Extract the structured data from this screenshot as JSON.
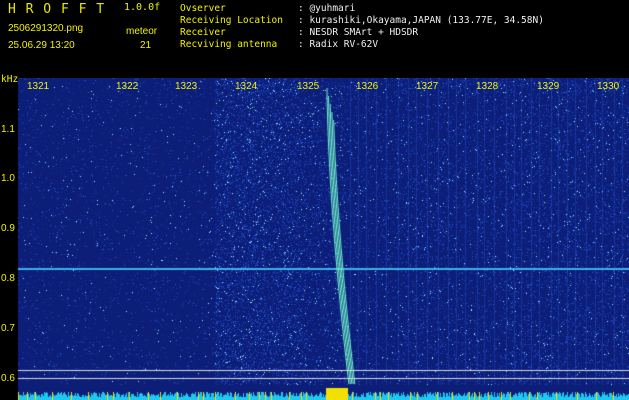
{
  "header": {
    "app_title": "H R O F F T",
    "version": "1.0.0f",
    "filename": "2506291320.png",
    "datetime": "25.06.29 13:20",
    "meteor_label": "meteor",
    "meteor_count": "21"
  },
  "info": [
    {
      "key": "Ovserver",
      "value": ": @yuhmari"
    },
    {
      "key": "Receiving Location",
      "value": ": kurashiki,Okayama,JAPAN (133.77E, 34.58N)"
    },
    {
      "key": "Receiver",
      "value": ": NESDR SMArt + HDSDR"
    },
    {
      "key": "Recviving antenna",
      "value": ": Radix RV-62V"
    }
  ],
  "axis": {
    "unit": "kHz",
    "x_ticks": [
      "1321",
      "1322",
      "1323",
      "1324",
      "1325",
      "1326",
      "1327",
      "1328",
      "1329",
      "1330"
    ],
    "y_ticks": [
      "1.1",
      "1.0",
      "0.9",
      "0.8",
      "0.7",
      "0.6"
    ]
  },
  "colors": {
    "label": "#f2f200",
    "text": "#f0f0f0",
    "background": "#000000",
    "spectrum_low": "#0a1a6e",
    "spectrum_high": "#2df0e0",
    "level_bar": "#1ec8f0"
  }
}
